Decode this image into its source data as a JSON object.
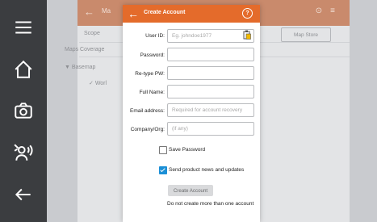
{
  "rail": {
    "items": [
      "menu",
      "home",
      "camera",
      "voice",
      "back"
    ]
  },
  "background": {
    "header_title": "Ma",
    "rows": [
      "Scope",
      "Maps Coverage",
      "Basemap",
      "Worl"
    ],
    "chip": "Map Store"
  },
  "dialog": {
    "title": "Create Account",
    "fields": {
      "user_id": {
        "label": "User ID:",
        "placeholder": "Eg. johndoe1977",
        "value": ""
      },
      "password": {
        "label": "Password:",
        "value": ""
      },
      "retype": {
        "label": "Re-type PW:",
        "value": ""
      },
      "full_name": {
        "label": "Full Name:",
        "value": ""
      },
      "email": {
        "label": "Email address:",
        "placeholder": "Required for account recovery",
        "value": ""
      },
      "company": {
        "label": "Company/Org:",
        "placeholder": "(if any)",
        "value": ""
      }
    },
    "save_password": {
      "label": "Save Password",
      "checked": false
    },
    "newsletter": {
      "label": "Send product news and updates",
      "checked": true
    },
    "create_button": "Create Account",
    "note": "Do not create more than one account"
  },
  "colors": {
    "accent": "#e46b2b",
    "checkbox": "#1b8fd6",
    "rail": "#3b3d40"
  }
}
